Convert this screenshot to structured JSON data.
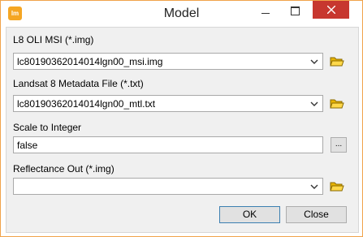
{
  "window": {
    "title": "Model",
    "app_icon_text": "lm"
  },
  "fields": [
    {
      "label": "L8 OLI MSI (*.img)",
      "value": "lc80190362014014lgn00_msi.img",
      "icon": "open-folder-icon"
    },
    {
      "label": "Landsat 8 Metadata File (*.txt)",
      "value": "lc80190362014014lgn00_mtl.txt",
      "icon": "open-folder-icon"
    },
    {
      "label": "Scale to Integer",
      "value": "false",
      "browse_label": "..."
    },
    {
      "label": "Reflectance Out (*.img)",
      "value": "",
      "icon": "open-folder-icon"
    }
  ],
  "buttons": {
    "ok": "OK",
    "close": "Close"
  },
  "colors": {
    "close_button": "#c7372f",
    "window_border": "#f0a34a",
    "folder": "#e8b400"
  }
}
